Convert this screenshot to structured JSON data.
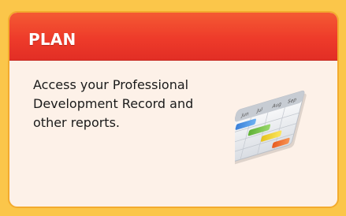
{
  "card": {
    "title": "PLAN",
    "description": "Access your Professional Development Record and other reports.",
    "icon": "gantt-chart-icon"
  },
  "icon_months": [
    "Jun",
    "Jul",
    "Aug",
    "Sep"
  ],
  "colors": {
    "page_background": "#fbc64a",
    "card_background": "#fdf1e8",
    "card_border": "#f3ab2e",
    "header_top": "#f45a33",
    "header_bottom": "#e22e25",
    "title_text": "#ffffff"
  }
}
